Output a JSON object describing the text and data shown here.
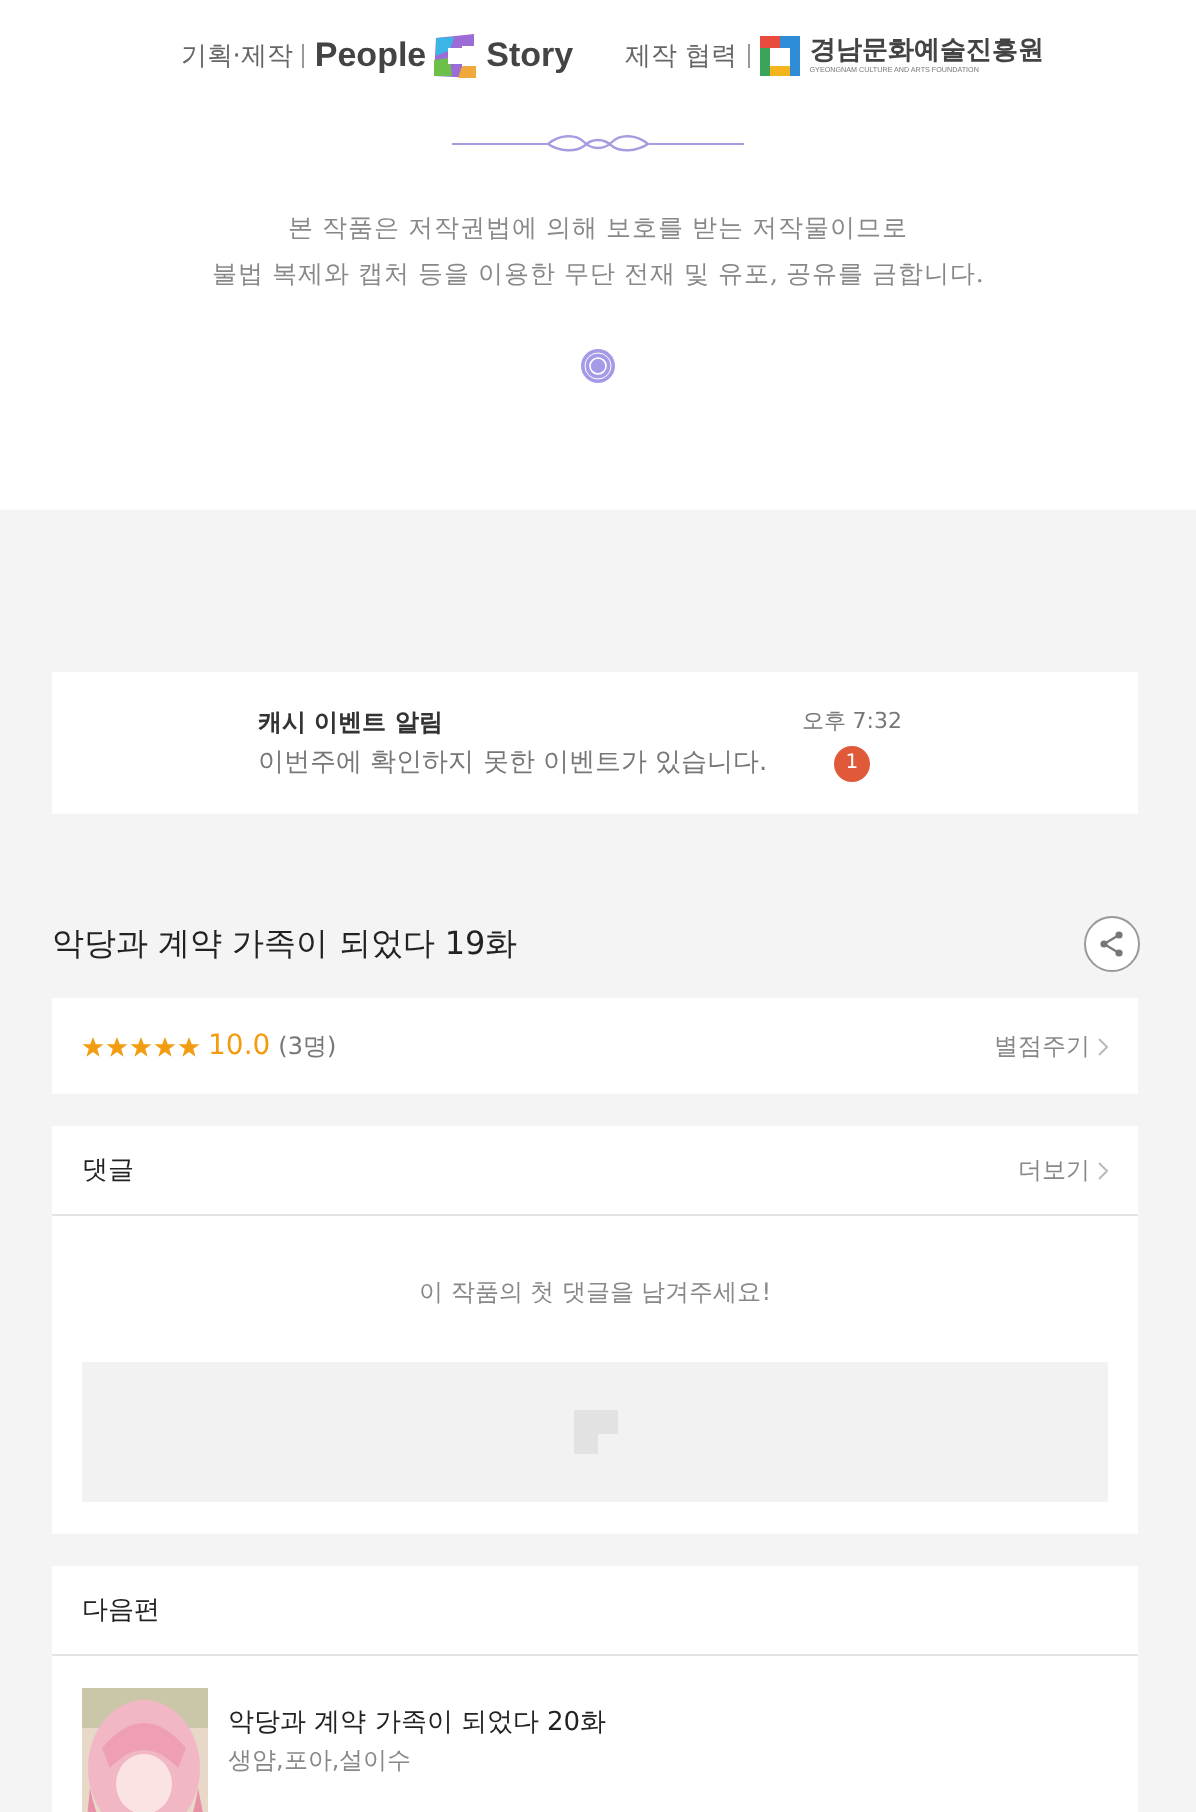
{
  "credits": {
    "production_label": "기획·제작",
    "producer_logo": {
      "word_1": "People",
      "word_2": "Story"
    },
    "cooperation_label": "제작 협력",
    "partner_logo": {
      "name": "경남문화예술진흥원",
      "subtitle": "GYEONGNAM CULTURE AND ARTS FOUNDATION"
    }
  },
  "copyright_notice": [
    "본 작품은 저작권법에 의해 보호를 받는 저작물이므로",
    "불법 복제와 캡처 등을 이용한 무단 전재 및 유포, 공유를 금합니다."
  ],
  "notification": {
    "title": "캐시 이벤트 알림",
    "message": "이번주에 확인하지 못한 이벤트가 있습니다.",
    "time": "오후 7:32",
    "badge": "1"
  },
  "episode_title": "악당과 계약 가족이 되었다 19화",
  "rating": {
    "stars": 5,
    "score": "10.0",
    "count": "(3명)",
    "action": "별점주기"
  },
  "comments": {
    "title": "댓글",
    "more": "더보기",
    "empty_message": "이 작품의 첫 댓글을 남겨주세요!"
  },
  "next_episode": {
    "title": "다음편",
    "item": {
      "title": "악당과 계약 가족이 되었다 20화",
      "authors": "생얌,포아,설이수"
    }
  }
}
